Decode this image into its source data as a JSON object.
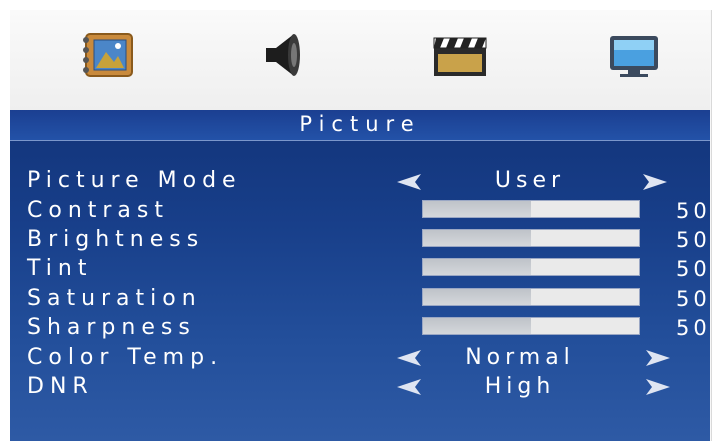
{
  "tabs": [
    {
      "icon": "picture-book-icon"
    },
    {
      "icon": "speaker-icon"
    },
    {
      "icon": "clapperboard-icon"
    },
    {
      "icon": "monitor-icon"
    }
  ],
  "header": {
    "title": "Picture"
  },
  "menu": {
    "picture_mode": {
      "label": "Picture Mode",
      "value": "User"
    },
    "contrast": {
      "label": "Contrast",
      "value": "50",
      "level": 0.5
    },
    "brightness": {
      "label": "Brightness",
      "value": "50",
      "level": 0.5
    },
    "tint": {
      "label": "Tint",
      "value": "50",
      "level": 0.5
    },
    "saturation": {
      "label": "Saturation",
      "value": "50",
      "level": 0.5
    },
    "sharpness": {
      "label": "Sharpness",
      "value": "50",
      "level": 0.5
    },
    "color_temp": {
      "label": "Color Temp.",
      "value": "Normal"
    },
    "dnr": {
      "label": "DNR",
      "value": "High"
    }
  },
  "colors": {
    "panel": "#1a3f8a",
    "title_bar": "#2352a8",
    "text": "#ffffff"
  }
}
